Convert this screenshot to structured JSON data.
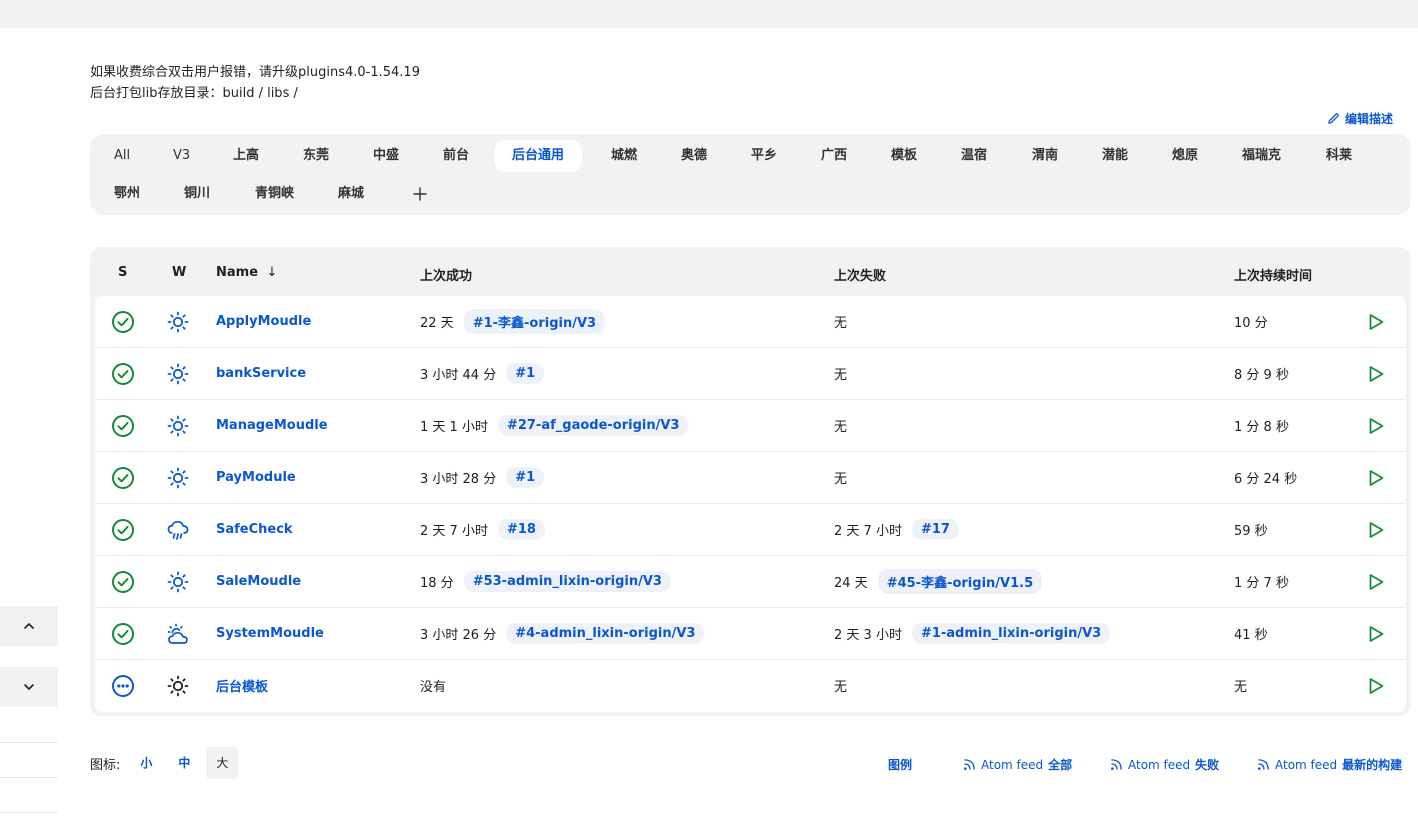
{
  "description": {
    "line1": "如果收费综合双击用户报错，请升级plugins4.0-1.54.19",
    "line2": "后台打包lib存放目录：build / libs /"
  },
  "edit_description_label": "编辑描述",
  "tabs": {
    "active": "后台通用",
    "items": [
      "All",
      "V3",
      "上高",
      "东莞",
      "中盛",
      "前台",
      "后台通用",
      "城燃",
      "奥德",
      "平乡",
      "广西",
      "模板",
      "温宿",
      "渭南",
      "潜能",
      "熄原",
      "福瑞克",
      "科莱",
      "鄂州",
      "铜川",
      "青铜峡",
      "麻城"
    ]
  },
  "table": {
    "headers": {
      "s": "S",
      "w": "W",
      "name": "Name",
      "sort_indicator": "↓",
      "last_success": "上次成功",
      "last_failure": "上次失败",
      "last_duration": "上次持续时间"
    },
    "rows": [
      {
        "status": "success",
        "weather": "sunny",
        "name": "ApplyMoudle",
        "success_time": "22 天",
        "success_build": "#1-李鑫-origin/V3",
        "failure_time": "无",
        "failure_build": "",
        "duration": "10 分"
      },
      {
        "status": "success",
        "weather": "sunny",
        "name": "bankService",
        "success_time": "3 小时 44 分",
        "success_build": "#1",
        "failure_time": "无",
        "failure_build": "",
        "duration": "8 分 9 秒"
      },
      {
        "status": "success",
        "weather": "sunny",
        "name": "ManageMoudle",
        "success_time": "1 天 1 小时",
        "success_build": "#27-af_gaode-origin/V3",
        "failure_time": "无",
        "failure_build": "",
        "duration": "1 分 8 秒"
      },
      {
        "status": "success",
        "weather": "sunny",
        "name": "PayModule",
        "success_time": "3 小时 28 分",
        "success_build": "#1",
        "failure_time": "无",
        "failure_build": "",
        "duration": "6 分 24 秒"
      },
      {
        "status": "success",
        "weather": "rainy",
        "name": "SafeCheck",
        "success_time": "2 天 7 小时",
        "success_build": "#18",
        "failure_time": "2 天 7 小时",
        "failure_build": "#17",
        "duration": "59 秒"
      },
      {
        "status": "success",
        "weather": "sunny",
        "name": "SaleMoudle",
        "success_time": "18 分",
        "success_build": "#53-admin_lixin-origin/V3",
        "failure_time": "24 天",
        "failure_build": "#45-李鑫-origin/V1.5",
        "duration": "1 分 7 秒"
      },
      {
        "status": "success",
        "weather": "cloudy",
        "name": "SystemMoudle",
        "success_time": "3 小时 26 分",
        "success_build": "#4-admin_lixin-origin/V3",
        "failure_time": "2 天 3 小时",
        "failure_build": "#1-admin_lixin-origin/V3",
        "duration": "41 秒"
      },
      {
        "status": "notbuilt",
        "weather": "sunny-dark",
        "name": "后台模板",
        "success_time": "没有",
        "success_build": "",
        "failure_time": "无",
        "failure_build": "",
        "duration": "无"
      }
    ]
  },
  "footer": {
    "icon_label": "图标:",
    "sizes": [
      "小",
      "中",
      "大"
    ],
    "active_size": "大",
    "legend": "图例",
    "atom_all_prefix": "Atom feed",
    "atom_all_suffix": "全部",
    "atom_fail_prefix": "Atom feed",
    "atom_fail_suffix": "失败",
    "atom_latest_prefix": "Atom feed",
    "atom_latest_suffix": "最新的构建"
  },
  "colors": {
    "accent": "#0b57d0",
    "success": "#138a36",
    "panel": "#f2f2f3"
  }
}
